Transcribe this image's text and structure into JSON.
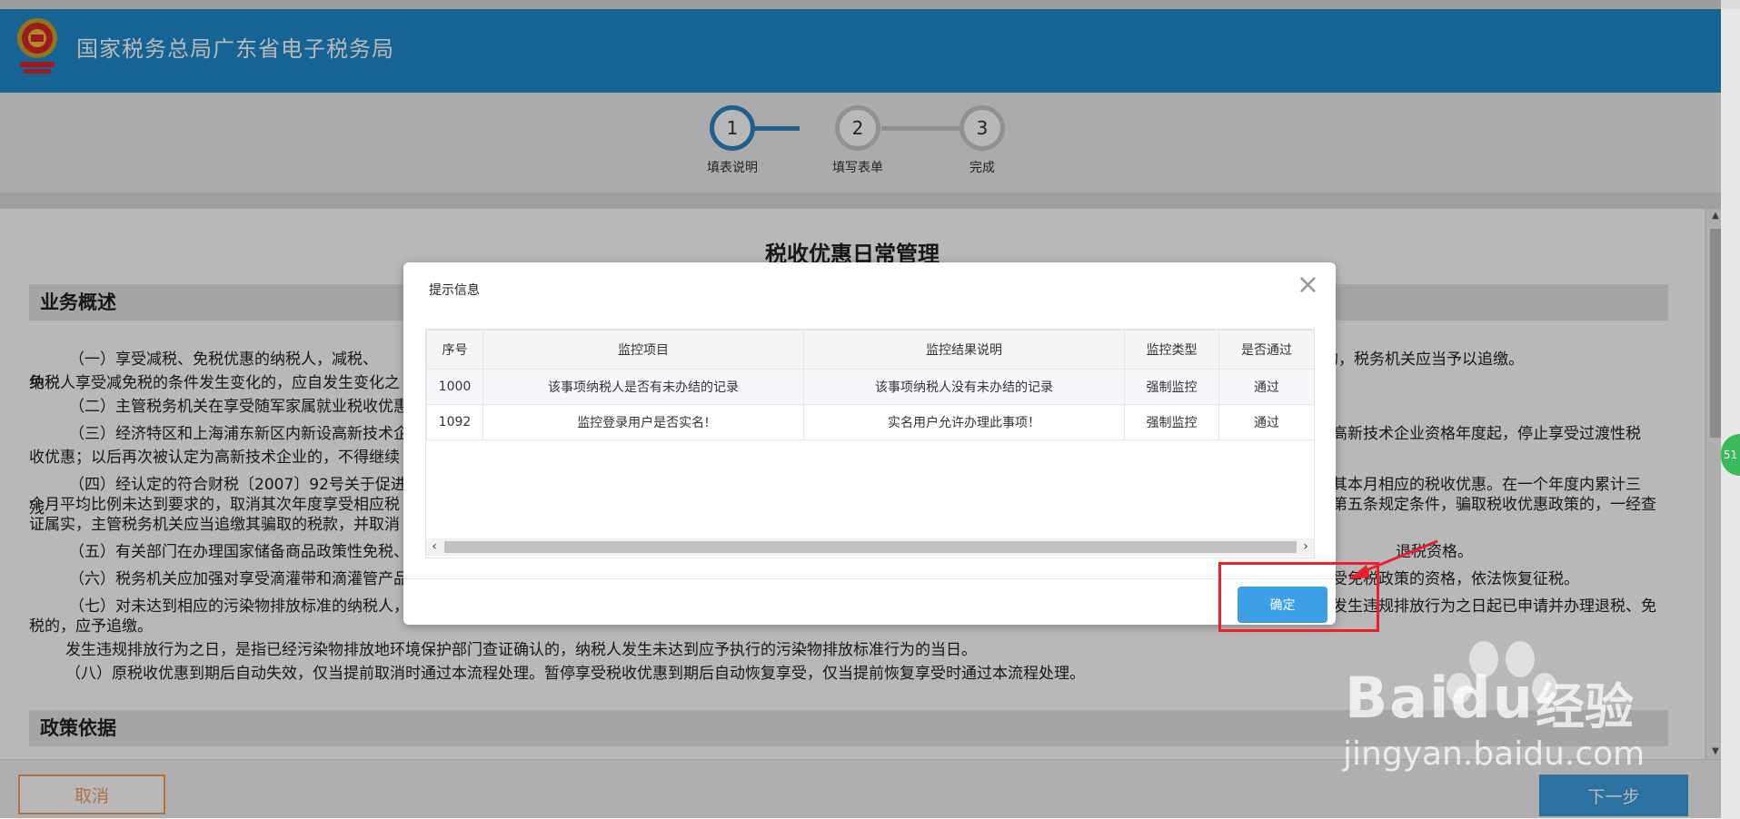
{
  "header": {
    "title": "国家税务总局广东省电子税务局"
  },
  "steps": [
    {
      "number": "1",
      "label": "填表说明"
    },
    {
      "number": "2",
      "label": "填写表单"
    },
    {
      "number": "3",
      "label": "完成"
    }
  ],
  "doc": {
    "title": "税收优惠日常管理",
    "section_overview": "业务概述",
    "section_policy": "政策依据",
    "paragraphs": [
      "（一）享受减税、免税优惠的纳税人，减税、免税",
      "的，税务机关应当予以追缴。",
      "纳税人享受减免税的条件发生变化的，应自发生变化之",
      "（二）主管税务机关在享受随军家属就业税收优惠",
      "（三）经济特区和上海浦东新区内新设高新技术企",
      "高新技术企业资格年度起，停止享受过渡性税",
      "收优惠；以后再次被认定为高新技术企业的，不得继续",
      "（四）经认定的符合财税〔2007〕92号关于促进残",
      "其本月相应的税收优惠。在一个年度内累计三",
      "个月平均比例未达到要求的，取消其次年度享受相应税",
      "第五条规定条件，骗取税收优惠政策的，一经查",
      "证属实，主管税务机关应当追缴其骗取的税款，并取消",
      "（五）有关部门在办理国家储备商品政策性免税、",
      "退税资格。",
      "（六）税务机关应加强对享受滴灌带和滴灌管产品",
      "受免税政策的资格，依法恢复征税。",
      "（七）对未达到相应的污染物排放标准的纳税人，",
      "发生违规排放行为之日起已申请并办理退税、免",
      "税的，应予追缴。",
      "发生违规排放行为之日，是指已经污染物排放地环境保护部门查证确认的，纳税人发生未达到应予执行的污染物排放标准行为的当日。",
      "（八）原税收优惠到期后自动失效，仅当提前取消时通过本流程处理。暂停享受税收优惠到期后自动恢复享受，仅当提前恢复享受时通过本流程处理。"
    ]
  },
  "footer": {
    "cancel_label": "取消",
    "next_label": "下一步"
  },
  "side_badge": "51",
  "modal": {
    "title": "提示信息",
    "close_glyph": "×",
    "columns": [
      "序号",
      "监控项目",
      "监控结果说明",
      "监控类型",
      "是否通过"
    ],
    "rows": [
      {
        "id": "1000",
        "item": "该事项纳税人是否有未办结的记录",
        "result": "该事项纳税人没有未办结的记录",
        "type": "强制监控",
        "pass": "通过"
      },
      {
        "id": "1092",
        "item": "监控登录用户是否实名!",
        "result": "实名用户允许办理此事项！",
        "type": "强制监控",
        "pass": "通过"
      }
    ],
    "ok_label": "确定"
  },
  "watermark": {
    "brand": "Bai",
    "brand2": "du",
    "cn": "经验",
    "sub": "jingyan.baidu.com"
  },
  "colors": {
    "header_blue": "#1f8bcd",
    "accent_blue": "#3d9fe5",
    "cancel_orange": "#f0a35a",
    "annotation_red": "#e8222b"
  }
}
